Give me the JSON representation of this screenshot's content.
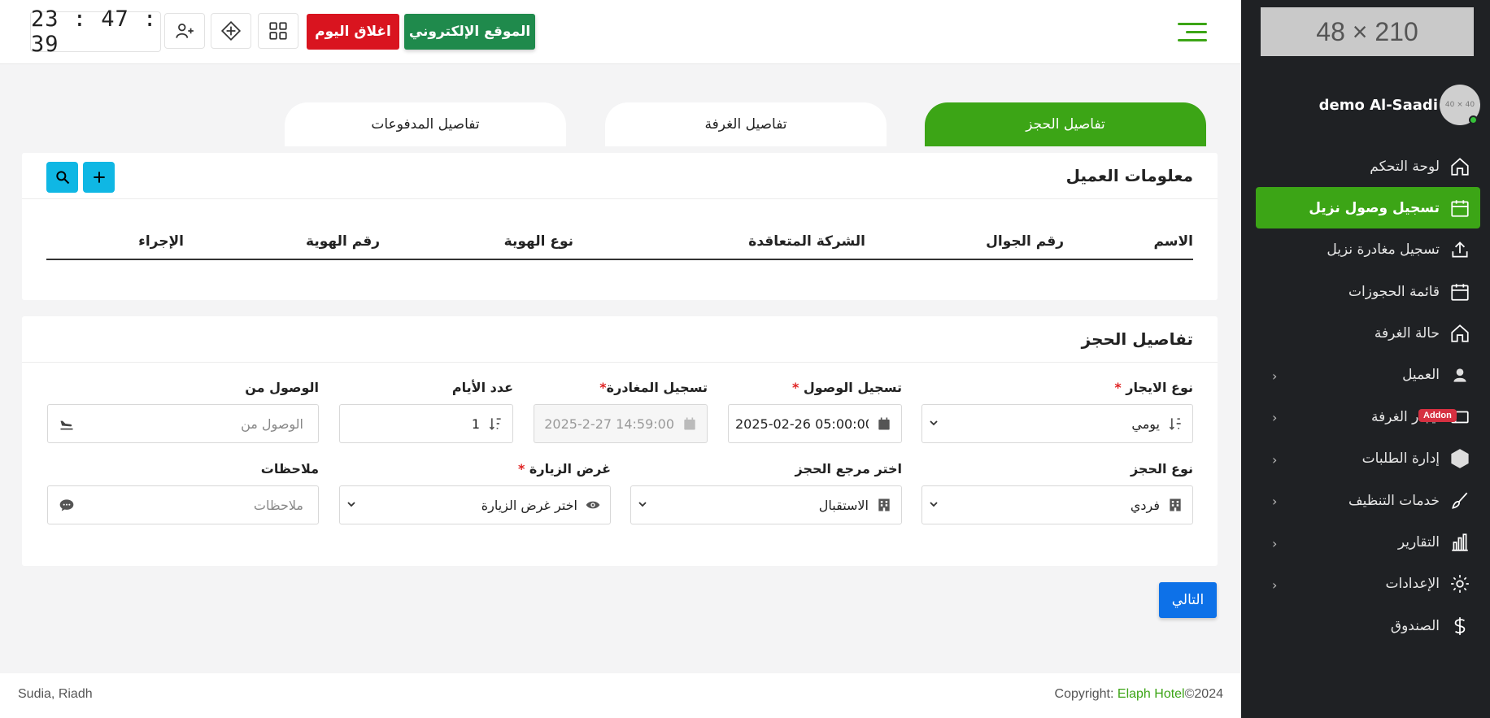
{
  "sidebar": {
    "logo_placeholder": "210 × 48",
    "avatar_placeholder": "40 × 40",
    "user_name": "demo Al-Saadi",
    "items": [
      {
        "label": "لوحة التحكم",
        "icon": "home-icon"
      },
      {
        "label": "تسجيل وصول نزيل",
        "icon": "calendar-icon",
        "active": true
      },
      {
        "label": "تسجيل مغادرة نزيل",
        "icon": "upload-icon"
      },
      {
        "label": "قائمة الحجوزات",
        "icon": "calendar-icon"
      },
      {
        "label": "حالة الغرفة",
        "icon": "home-icon"
      },
      {
        "label": "العميل",
        "icon": "user-icon"
      },
      {
        "label": "ايجار الغرفة",
        "icon": "tablet-icon",
        "badge": "Addon"
      },
      {
        "label": "إدارة الطلبات",
        "icon": "hexagon-icon"
      },
      {
        "label": "خدمات التنظيف",
        "icon": "broom-icon"
      },
      {
        "label": "التقارير",
        "icon": "chart-icon"
      },
      {
        "label": "الإعدادات",
        "icon": "gear-icon"
      },
      {
        "label": "الصندوق",
        "icon": "dollar-icon"
      }
    ]
  },
  "topbar": {
    "website_label": "الموقع الإلكتروني",
    "close_day_label": "اغلاق اليوم",
    "clock": "23 : 47 : 39"
  },
  "tabs": [
    {
      "label": "تفاصيل الحجز",
      "active": true
    },
    {
      "label": "تفاصيل الغرفة"
    },
    {
      "label": "تفاصيل المدفوعات"
    }
  ],
  "customer_card": {
    "title": "معلومات العميل",
    "columns": [
      "الاسم",
      "رقم الجوال",
      "الشركة المتعاقدة",
      "نوع الهوية",
      "رقم الهوية",
      "الإجراء"
    ]
  },
  "booking_card": {
    "title": "تفاصيل الحجز",
    "rent_type": {
      "label": "نوع الايجار",
      "required": "*",
      "value": "يومي"
    },
    "checkin": {
      "label": "تسجيل الوصول",
      "required": "*",
      "value": "2025-02-26 05:00:00"
    },
    "checkout": {
      "label": "تسجيل المغادرة",
      "required": "*",
      "value": "2025-2-27 14:59:00"
    },
    "days": {
      "label": "عدد الأيام",
      "value": "1"
    },
    "arrival_from": {
      "label": "الوصول من",
      "placeholder": "الوصول من"
    },
    "booking_type": {
      "label": "نوع الحجز",
      "value": "فردي"
    },
    "booking_ref": {
      "label": "اختر مرجع الحجز",
      "value": "الاستقبال"
    },
    "visit_purpose": {
      "label": "غرض الزيارة",
      "required": "*",
      "value": "اختر غرض الزيارة"
    },
    "notes": {
      "label": "ملاحظات",
      "placeholder": "ملاحظات"
    }
  },
  "next_label": "التالي",
  "footer": {
    "location": "Sudia, Riadh",
    "copyright_prefix": "Copyright: ",
    "brand": "Elaph Hotel",
    "copyright_suffix": "©2024"
  }
}
